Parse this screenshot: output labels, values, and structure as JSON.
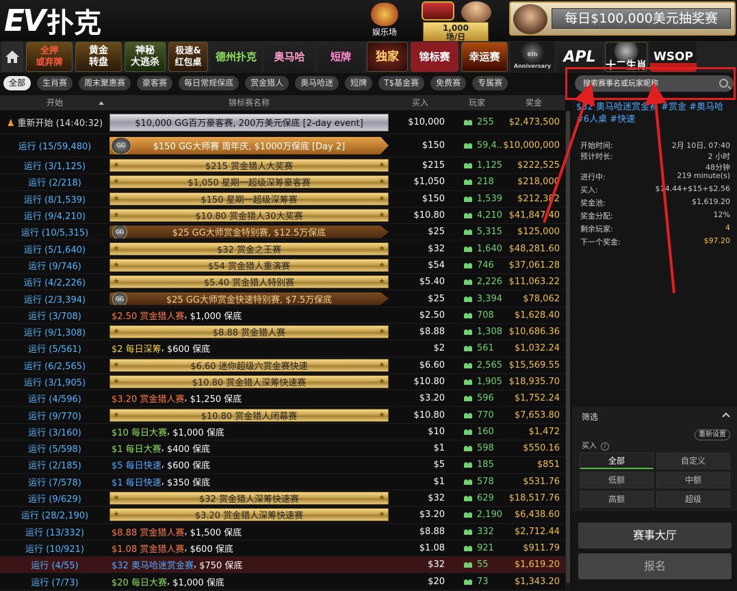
{
  "brand": {
    "logo_letters": "EV",
    "logo_text": "扑克"
  },
  "top": {
    "casino_label": "娱乐场",
    "slot_count": "1,000",
    "slot_unit": "场/日",
    "promo_text": "每日$100,000美元抽奖赛"
  },
  "nav": {
    "items": [
      "全押\n或弃牌",
      "黄金\n转盘",
      "神秘\n大逃杀",
      "极速&\n红包桌",
      "德州扑克",
      "奥马哈",
      "短牌",
      "独家",
      "锦标赛",
      "幸运赛",
      "6th Anniversary",
      "APL",
      "十二生肖",
      "WSOP"
    ],
    "active": "锦标赛"
  },
  "chips": [
    "全部",
    "生肖赛",
    "周末聚惠赛",
    "豪客赛",
    "每日常规保底",
    "赏金猎人",
    "奥马哈迷",
    "短牌",
    "T$基金赛",
    "免费赛",
    "专属赛"
  ],
  "search": {
    "placeholder": "搜索赛事名或玩家昵称"
  },
  "table": {
    "headers": {
      "start": "开始",
      "name": "锦标赛名称",
      "buyin": "买入",
      "players": "玩家",
      "prize": "奖金"
    },
    "rows": [
      {
        "start": "重新开始 (14:40:32)",
        "name": "$10,000 GG百万豪客赛, 200万美元保底 [2-day event]",
        "style": "silver",
        "buyin": "$10,000",
        "players": "255",
        "prize": "$2,473,500",
        "tall": true
      },
      {
        "start": "运行 (15/59,480)",
        "name": "$150 GG大师赛 周年庆, $1000万保底 [Day 2]",
        "style": "ggbig",
        "buyin": "$150",
        "players": "59,4..",
        "prize": "$10,000,000",
        "tall": true
      },
      {
        "start": "运行 (3/1,125)",
        "name": "$215 赏金猎人大奖赛",
        "style": "gold",
        "buyin": "$215",
        "players": "1,125",
        "prize": "$222,525"
      },
      {
        "start": "运行 (2/218)",
        "name": "$1,050 星期一超级深筹豪客赛",
        "style": "gold",
        "buyin": "$1,050",
        "players": "218",
        "prize": "$218,000"
      },
      {
        "start": "运行 (8/1,539)",
        "name": "$150 星期一超级深筹赛",
        "style": "gold",
        "buyin": "$150",
        "players": "1,539",
        "prize": "$212,382"
      },
      {
        "start": "运行 (9/4,210)",
        "name": "$10.80 赏金猎人30大奖赛",
        "style": "gold",
        "buyin": "$10.80",
        "players": "4,210",
        "prize": "$41,847.40"
      },
      {
        "start": "运行 (10/5,315)",
        "name": "$25 GG大师赏金特别赛, $12.5万保底",
        "style": "gg",
        "buyin": "$25",
        "players": "5,315",
        "prize": "$125,000"
      },
      {
        "start": "运行 (5/1,640)",
        "name": "$32 赏金之王赛",
        "style": "gold",
        "buyin": "$32",
        "players": "1,640",
        "prize": "$48,281.60"
      },
      {
        "start": "运行 (9/746)",
        "name": "$54 赏金猎人重演赛",
        "style": "gold",
        "buyin": "$54",
        "players": "746",
        "prize": "$37,061.28"
      },
      {
        "start": "运行 (4/2,226)",
        "name": "$5.40 赏金猎人特别赛",
        "style": "gold",
        "buyin": "$5.40",
        "players": "2,226",
        "prize": "$11,063.22"
      },
      {
        "start": "运行 (2/3,394)",
        "name": "$25 GG大师赏金快速特别赛, $7.5万保底",
        "style": "gg",
        "buyin": "$25",
        "players": "3,394",
        "prize": "$78,062"
      },
      {
        "start": "运行 (3/708)",
        "name": "",
        "plain": [
          "$2.50 赏金猎人赛",
          "$1,000 保底",
          "c-o"
        ],
        "buyin": "$2.50",
        "players": "708",
        "prize": "$1,628.40"
      },
      {
        "start": "运行 (9/1,308)",
        "name": "$8.88 赏金猎人赛",
        "style": "gold",
        "buyin": "$8.88",
        "players": "1,308",
        "prize": "$10,686.36"
      },
      {
        "start": "运行 (5/561)",
        "name": "",
        "plain": [
          "$2 每日深筹",
          "$600 保底",
          "c-y"
        ],
        "buyin": "$2",
        "players": "561",
        "prize": "$1,032.24"
      },
      {
        "start": "运行 (6/2,565)",
        "name": "$6.60 迷你超级六赏金赛快速",
        "style": "gold",
        "buyin": "$6.60",
        "players": "2,565",
        "prize": "$15,569.55"
      },
      {
        "start": "运行 (3/1,905)",
        "name": "$10.80 赏金猎人深筹快速赛",
        "style": "gold",
        "buyin": "$10.80",
        "players": "1,905",
        "prize": "$18,935.70"
      },
      {
        "start": "运行 (4/596)",
        "name": "",
        "plain": [
          "$3.20 赏金猎人赛",
          "$1,250 保底",
          "c-o"
        ],
        "buyin": "$3.20",
        "players": "596",
        "prize": "$1,752.24"
      },
      {
        "start": "运行 (9/770)",
        "name": "$10.80 赏金猎人闭幕赛",
        "style": "gold",
        "buyin": "$10.80",
        "players": "770",
        "prize": "$7,653.80"
      },
      {
        "start": "运行 (3/160)",
        "name": "",
        "plain": [
          "$10 每日大赛",
          "$1,000 保底",
          "c-g"
        ],
        "buyin": "$10",
        "players": "160",
        "prize": "$1,472"
      },
      {
        "start": "运行 (5/598)",
        "name": "",
        "plain": [
          "$1 每日大赛",
          "$400 保底",
          "c-g"
        ],
        "buyin": "$1",
        "players": "598",
        "prize": "$550.16"
      },
      {
        "start": "运行 (2/185)",
        "name": "",
        "plain": [
          "$5 每日快速",
          "$600 保底",
          "c-b"
        ],
        "buyin": "$5",
        "players": "185",
        "prize": "$851"
      },
      {
        "start": "运行 (7/578)",
        "name": "",
        "plain": [
          "$1 每日快速",
          "$350 保底",
          "c-b"
        ],
        "buyin": "$1",
        "players": "578",
        "prize": "$531.76"
      },
      {
        "start": "运行 (9/629)",
        "name": "$32 赏金猎人深筹快速赛",
        "style": "gold",
        "buyin": "$32",
        "players": "629",
        "prize": "$18,517.76"
      },
      {
        "start": "运行 (28/2,190)",
        "name": "$3.20 赏金猎人深筹快速赛",
        "style": "gold",
        "buyin": "$3.20",
        "players": "2,190",
        "prize": "$6,438.60"
      },
      {
        "start": "运行 (13/332)",
        "name": "",
        "plain": [
          "$8.88 赏金猎人赛",
          "$1,500 保底",
          "c-o"
        ],
        "buyin": "$8.88",
        "players": "332",
        "prize": "$2,712.44"
      },
      {
        "start": "运行 (10/921)",
        "name": "",
        "plain": [
          "$1.08 赏金猎人赛",
          "$600 保底",
          "c-o"
        ],
        "buyin": "$1.08",
        "players": "921",
        "prize": "$911.79"
      },
      {
        "start": "运行 (4/55)",
        "name": "",
        "plain": [
          "$32 奥马哈迷赏金赛",
          "$750 保底",
          "c-b"
        ],
        "buyin": "$32",
        "players": "55",
        "prize": "$1,619.20",
        "selected": true
      },
      {
        "start": "运行 (7/73)",
        "name": "",
        "plain": [
          "$20 每日大赛",
          "$1,000 保底",
          "c-g"
        ],
        "buyin": "$20",
        "players": "73",
        "prize": "$1,343.20"
      }
    ]
  },
  "detail": {
    "title": "$32 奥马哈迷赏金赛 #赏金 #奥马哈 #6人桌 #快速",
    "info": [
      {
        "k": "开始时间:",
        "v": "2月 10日, 07:40"
      },
      {
        "k": "预计时长:",
        "v": "2 小时\n48分钟"
      },
      {
        "k": "进行中:",
        "v": "219 minute(s)"
      },
      {
        "k": "买入:",
        "v": "$14.44+$15+$2.56"
      },
      {
        "k": "奖金池:",
        "v": "$1,619.20"
      },
      {
        "k": "奖金分配:",
        "v": "12%"
      },
      {
        "k": "剩余玩家:",
        "v": "4"
      },
      {
        "k": "下一个奖金:",
        "v": "$97.20"
      }
    ]
  },
  "filter": {
    "title": "筛选",
    "reset": "重新设置",
    "buyin_label": "买入",
    "info_icon": "i",
    "options": [
      "全部",
      "自定义",
      "低额",
      "中额",
      "高额",
      "超级"
    ],
    "selected": "全部"
  },
  "buttons": {
    "lobby": "赛事大厅",
    "register": "报名"
  },
  "colors": {
    "accent_red": "#8b1c22",
    "link_blue": "#4fa8ff",
    "prize_gold": "#f0c040",
    "players_green": "#6fd36f",
    "annotation_red": "#e02020"
  }
}
